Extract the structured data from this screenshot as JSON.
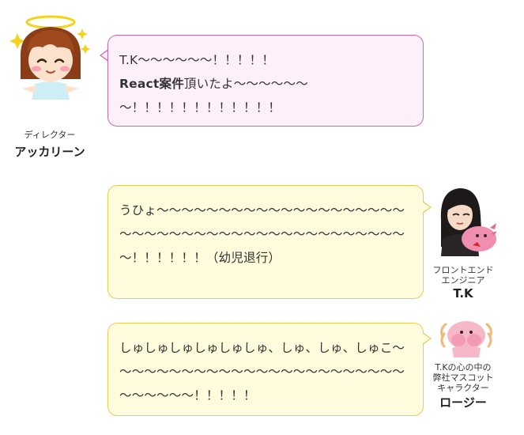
{
  "messages": [
    {
      "speaker_role": "ディレクター",
      "speaker_name": "アッカリーン",
      "line1": "T.K〜〜〜〜〜〜！！！！！",
      "line2_bold": "React案件",
      "line2_rest": "頂いたよ〜〜〜〜〜〜",
      "line3": "〜！！！！！！！！！！！！",
      "colors": {
        "bg": "#fdf0fb",
        "border": "#cc6aa6"
      }
    },
    {
      "speaker_role_line1": "フロントエンド",
      "speaker_role_line2": "エンジニア",
      "speaker_name": "T.K",
      "line1": "うひょ〜〜〜〜〜〜〜〜〜〜〜〜〜〜〜〜〜〜〜〜",
      "line2": "〜〜〜〜〜〜〜〜〜〜〜〜〜〜〜〜〜〜〜〜〜〜〜",
      "line3": "〜！！！！！！（幼児退行）",
      "colors": {
        "bg": "#fffbdd",
        "border": "#e7cc55"
      }
    },
    {
      "speaker_role_line1": "T.Kの心の中の",
      "speaker_role_line2": "弊社マスコット",
      "speaker_role_line3": "キャラクター",
      "speaker_name": "ロージー",
      "line1": "しゅしゅしゅしゅしゅしゅ、しゅ、しゅ、しゅこ〜",
      "line2": "〜〜〜〜〜〜〜〜〜〜〜〜〜〜〜〜〜〜〜〜〜〜〜",
      "line3": "〜〜〜〜〜〜！！！！！",
      "colors": {
        "bg": "#fffbdd",
        "border": "#e7cc55"
      }
    }
  ],
  "avatars": {
    "akkarin": "girl-with-halo-icon",
    "tk": "woman-with-pink-axolotl-icon",
    "rosie": "pink-axolotl-mascot-icon"
  }
}
